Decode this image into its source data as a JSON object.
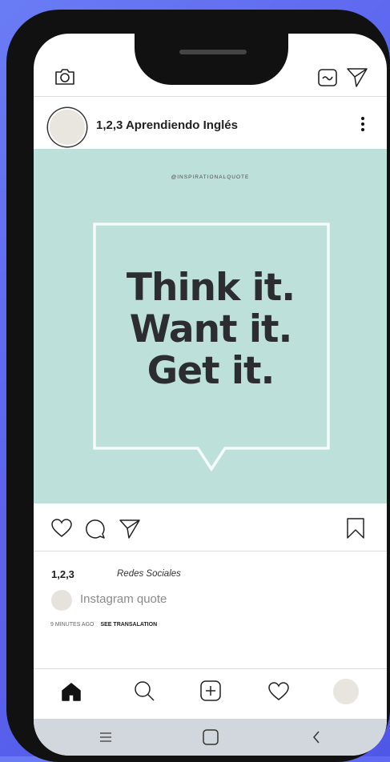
{
  "profile": {
    "username": "1,2,3 Aprendiendo Inglés"
  },
  "post": {
    "handle": "@INSPIRATIONALQUOTE",
    "lines": [
      "Think it.",
      "Want it.",
      "Get it."
    ],
    "background_color": "#bde1da",
    "text_color": "#2c2d30"
  },
  "caption": {
    "author": "1,2,3",
    "text": "Redes Sociales",
    "comment_placeholder": "Instagram quote",
    "time": "9 MINUTES AGO",
    "translate": "SEE TRANSALATION"
  },
  "icons": {
    "top": [
      "camera-icon",
      "reels-icon",
      "send-icon"
    ],
    "actions": [
      "heart-icon",
      "comment-icon",
      "share-icon",
      "bookmark-icon"
    ],
    "bottom_nav": [
      "home-icon",
      "search-icon",
      "add-post-icon",
      "activity-heart-icon",
      "profile-avatar"
    ],
    "system": [
      "menu-icon",
      "home-square-icon",
      "back-icon"
    ]
  }
}
